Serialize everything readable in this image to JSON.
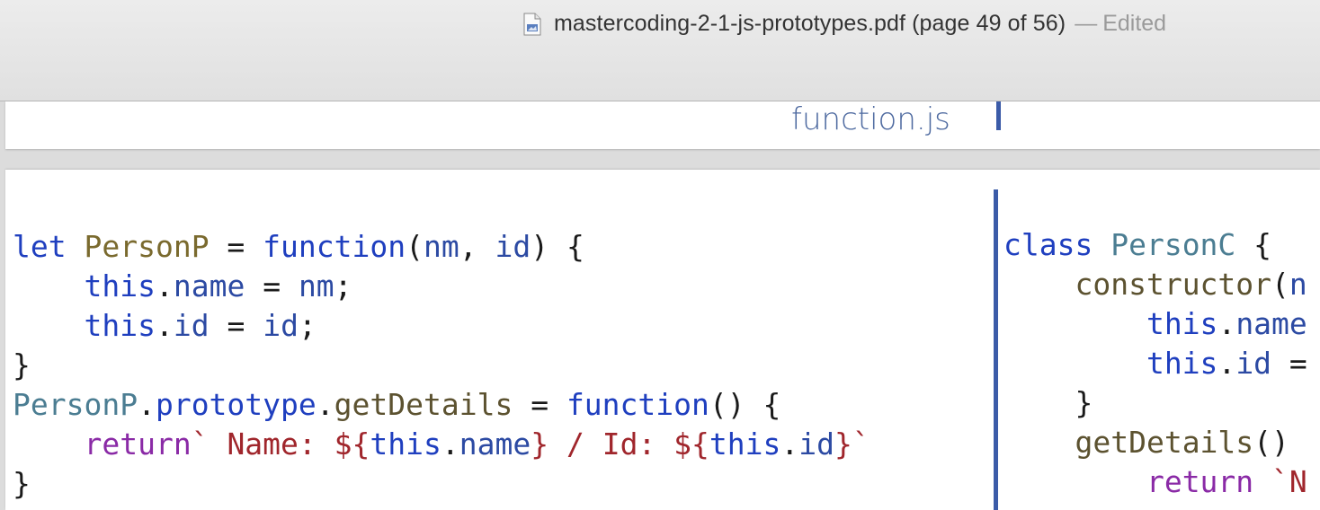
{
  "window": {
    "title": "mastercoding-2-1-js-prototypes.pdf (page 49 of 56)",
    "separator": "—",
    "status": "Edited"
  },
  "page_header": {
    "file_label": "function.js"
  },
  "code_left": {
    "lines": [
      [
        {
          "t": "let",
          "c": "kw"
        },
        {
          "t": " ",
          "c": "pl"
        },
        {
          "t": "PersonP",
          "c": "ty"
        },
        {
          "t": " = ",
          "c": "pl"
        },
        {
          "t": "function",
          "c": "kw"
        },
        {
          "t": "(",
          "c": "pl"
        },
        {
          "t": "nm",
          "c": "id"
        },
        {
          "t": ", ",
          "c": "pl"
        },
        {
          "t": "id",
          "c": "id"
        },
        {
          "t": ") {",
          "c": "pl"
        }
      ],
      [
        {
          "t": "    ",
          "c": "pl"
        },
        {
          "t": "this",
          "c": "kw"
        },
        {
          "t": ".",
          "c": "pl"
        },
        {
          "t": "name",
          "c": "id"
        },
        {
          "t": " = ",
          "c": "pl"
        },
        {
          "t": "nm",
          "c": "id"
        },
        {
          "t": ";",
          "c": "pl"
        }
      ],
      [
        {
          "t": "    ",
          "c": "pl"
        },
        {
          "t": "this",
          "c": "kw"
        },
        {
          "t": ".",
          "c": "pl"
        },
        {
          "t": "id",
          "c": "id"
        },
        {
          "t": " = ",
          "c": "pl"
        },
        {
          "t": "id",
          "c": "id"
        },
        {
          "t": ";",
          "c": "pl"
        }
      ],
      [
        {
          "t": "}",
          "c": "pl"
        }
      ],
      [
        {
          "t": "PersonP",
          "c": "cl"
        },
        {
          "t": ".",
          "c": "pl"
        },
        {
          "t": "prototype",
          "c": "kw"
        },
        {
          "t": ".",
          "c": "pl"
        },
        {
          "t": "getDetails",
          "c": "fn"
        },
        {
          "t": " = ",
          "c": "pl"
        },
        {
          "t": "function",
          "c": "kw"
        },
        {
          "t": "() {",
          "c": "pl"
        }
      ],
      [
        {
          "t": "    ",
          "c": "pl"
        },
        {
          "t": "return",
          "c": "rt"
        },
        {
          "t": "` Name: ${",
          "c": "st"
        },
        {
          "t": "this",
          "c": "kw"
        },
        {
          "t": ".",
          "c": "pl"
        },
        {
          "t": "name",
          "c": "id"
        },
        {
          "t": "} / Id: ${",
          "c": "st"
        },
        {
          "t": "this",
          "c": "kw"
        },
        {
          "t": ".",
          "c": "pl"
        },
        {
          "t": "id",
          "c": "id"
        },
        {
          "t": "}`",
          "c": "st"
        }
      ],
      [
        {
          "t": "}",
          "c": "pl"
        }
      ]
    ]
  },
  "code_right": {
    "lines": [
      [
        {
          "t": "class",
          "c": "kw"
        },
        {
          "t": " ",
          "c": "pl"
        },
        {
          "t": "PersonC",
          "c": "cl"
        },
        {
          "t": " {",
          "c": "pl"
        }
      ],
      [
        {
          "t": "    ",
          "c": "pl"
        },
        {
          "t": "constructor",
          "c": "fn"
        },
        {
          "t": "(",
          "c": "pl"
        },
        {
          "t": "n",
          "c": "id"
        }
      ],
      [
        {
          "t": "        ",
          "c": "pl"
        },
        {
          "t": "this",
          "c": "kw"
        },
        {
          "t": ".",
          "c": "pl"
        },
        {
          "t": "name",
          "c": "id"
        }
      ],
      [
        {
          "t": "        ",
          "c": "pl"
        },
        {
          "t": "this",
          "c": "kw"
        },
        {
          "t": ".",
          "c": "pl"
        },
        {
          "t": "id",
          "c": "id"
        },
        {
          "t": " =",
          "c": "pl"
        }
      ],
      [
        {
          "t": "    }",
          "c": "pl"
        }
      ],
      [
        {
          "t": "    ",
          "c": "pl"
        },
        {
          "t": "getDetails",
          "c": "fn"
        },
        {
          "t": "()",
          "c": "pl"
        }
      ],
      [
        {
          "t": "        ",
          "c": "pl"
        },
        {
          "t": "return",
          "c": "rt"
        },
        {
          "t": " `N",
          "c": "st"
        }
      ]
    ]
  },
  "colors": {
    "keyword": "#1f3fbf",
    "identifier": "#2c4aa3",
    "type": "#7a6a2e",
    "method": "#5c5230",
    "string": "#a0262c",
    "return": "#8a2aa6",
    "class_ref": "#4b7d92",
    "accent_bar": "#3b5ba8"
  },
  "icons": {
    "document": "pdf-document-icon"
  }
}
